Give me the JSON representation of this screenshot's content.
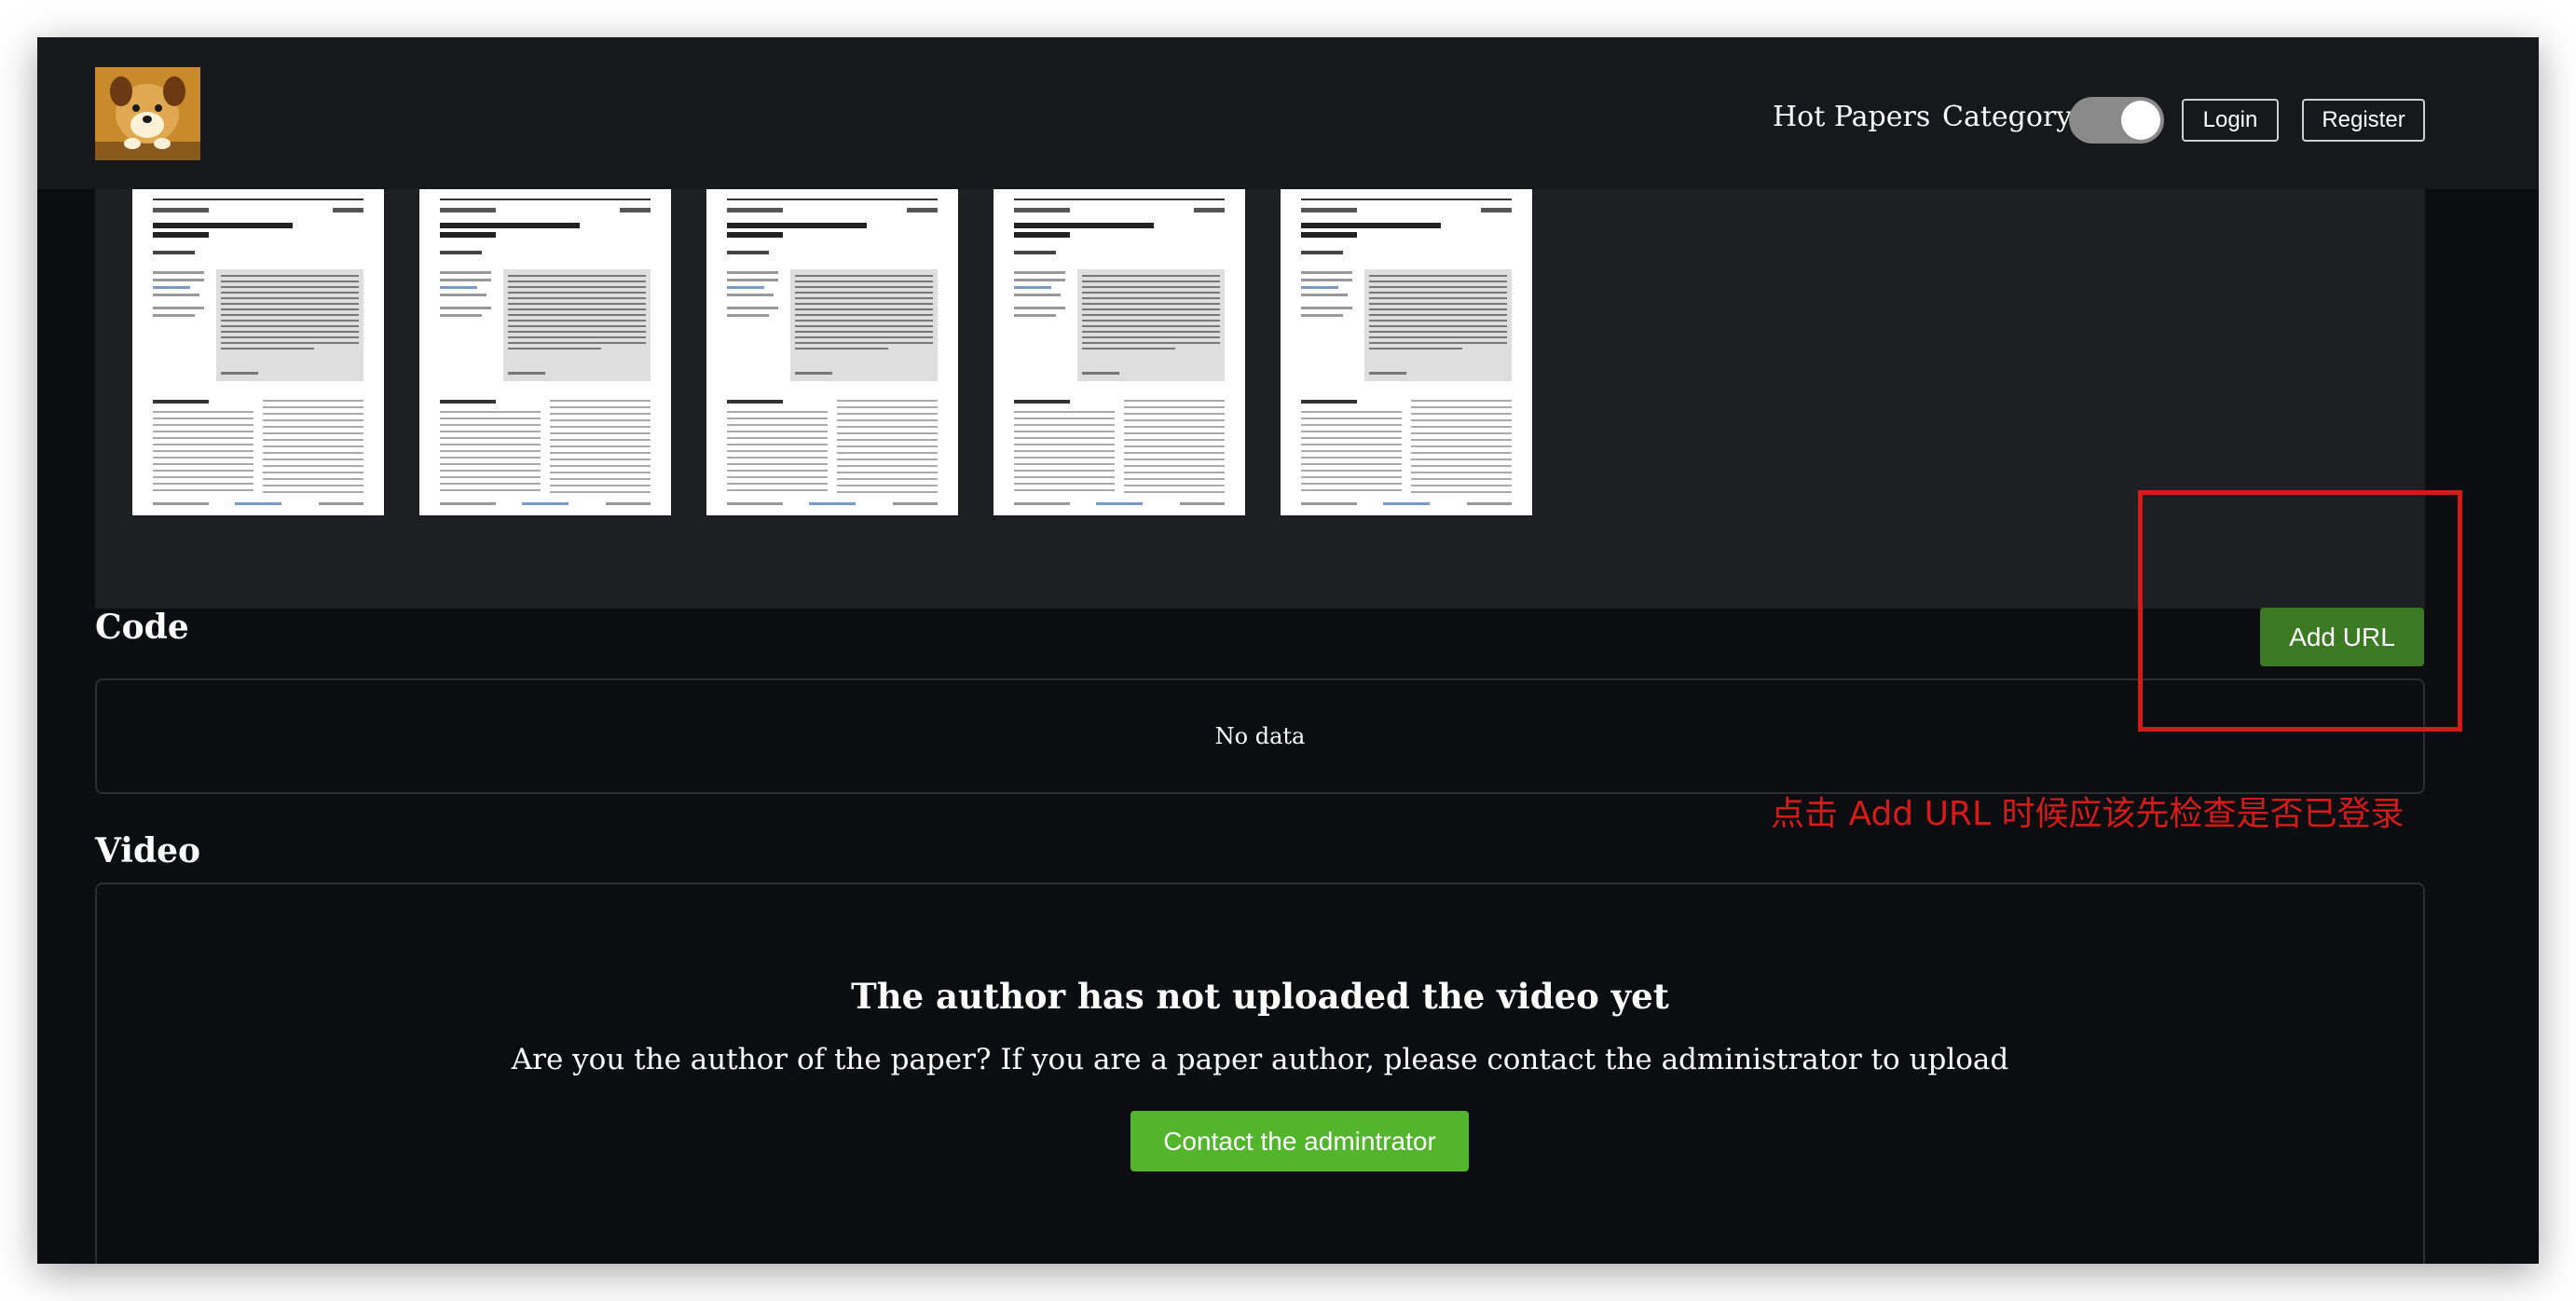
{
  "header": {
    "nav": [
      "Hot Papers",
      "Category"
    ],
    "login_label": "Login",
    "register_label": "Register",
    "theme_toggle_on": true
  },
  "gallery": {
    "thumbnails": [
      {
        "title": "Digital inequalities in the age of artificial intelligence and big data"
      },
      {
        "title": "Digital inequalities in the age of artificial intelligence and big data"
      },
      {
        "title": "Digital inequalities in the age of artificial intelligence and big data"
      },
      {
        "title": "Digital inequalities in the age of artificial intelligence and big data"
      },
      {
        "title": "Digital inequalities in the age of artificial intelligence and big data"
      }
    ]
  },
  "code": {
    "title": "Code",
    "add_url_label": "Add URL",
    "empty_text": "No data"
  },
  "video": {
    "title": "Video",
    "empty_title": "The author has not uploaded the video yet",
    "empty_text": "Are you the author of the paper? If you are a paper author, please contact the administrator to upload",
    "contact_label": "Contact the admintrator"
  },
  "annotation": {
    "text": "点击 Add URL 时候应该先检查是否已登录"
  },
  "colors": {
    "background": "#0c0d10",
    "header": "#16181c",
    "add_url_green": "#3b7a22",
    "contact_green": "#52b52c",
    "annotation_red": "#d51a1a"
  }
}
